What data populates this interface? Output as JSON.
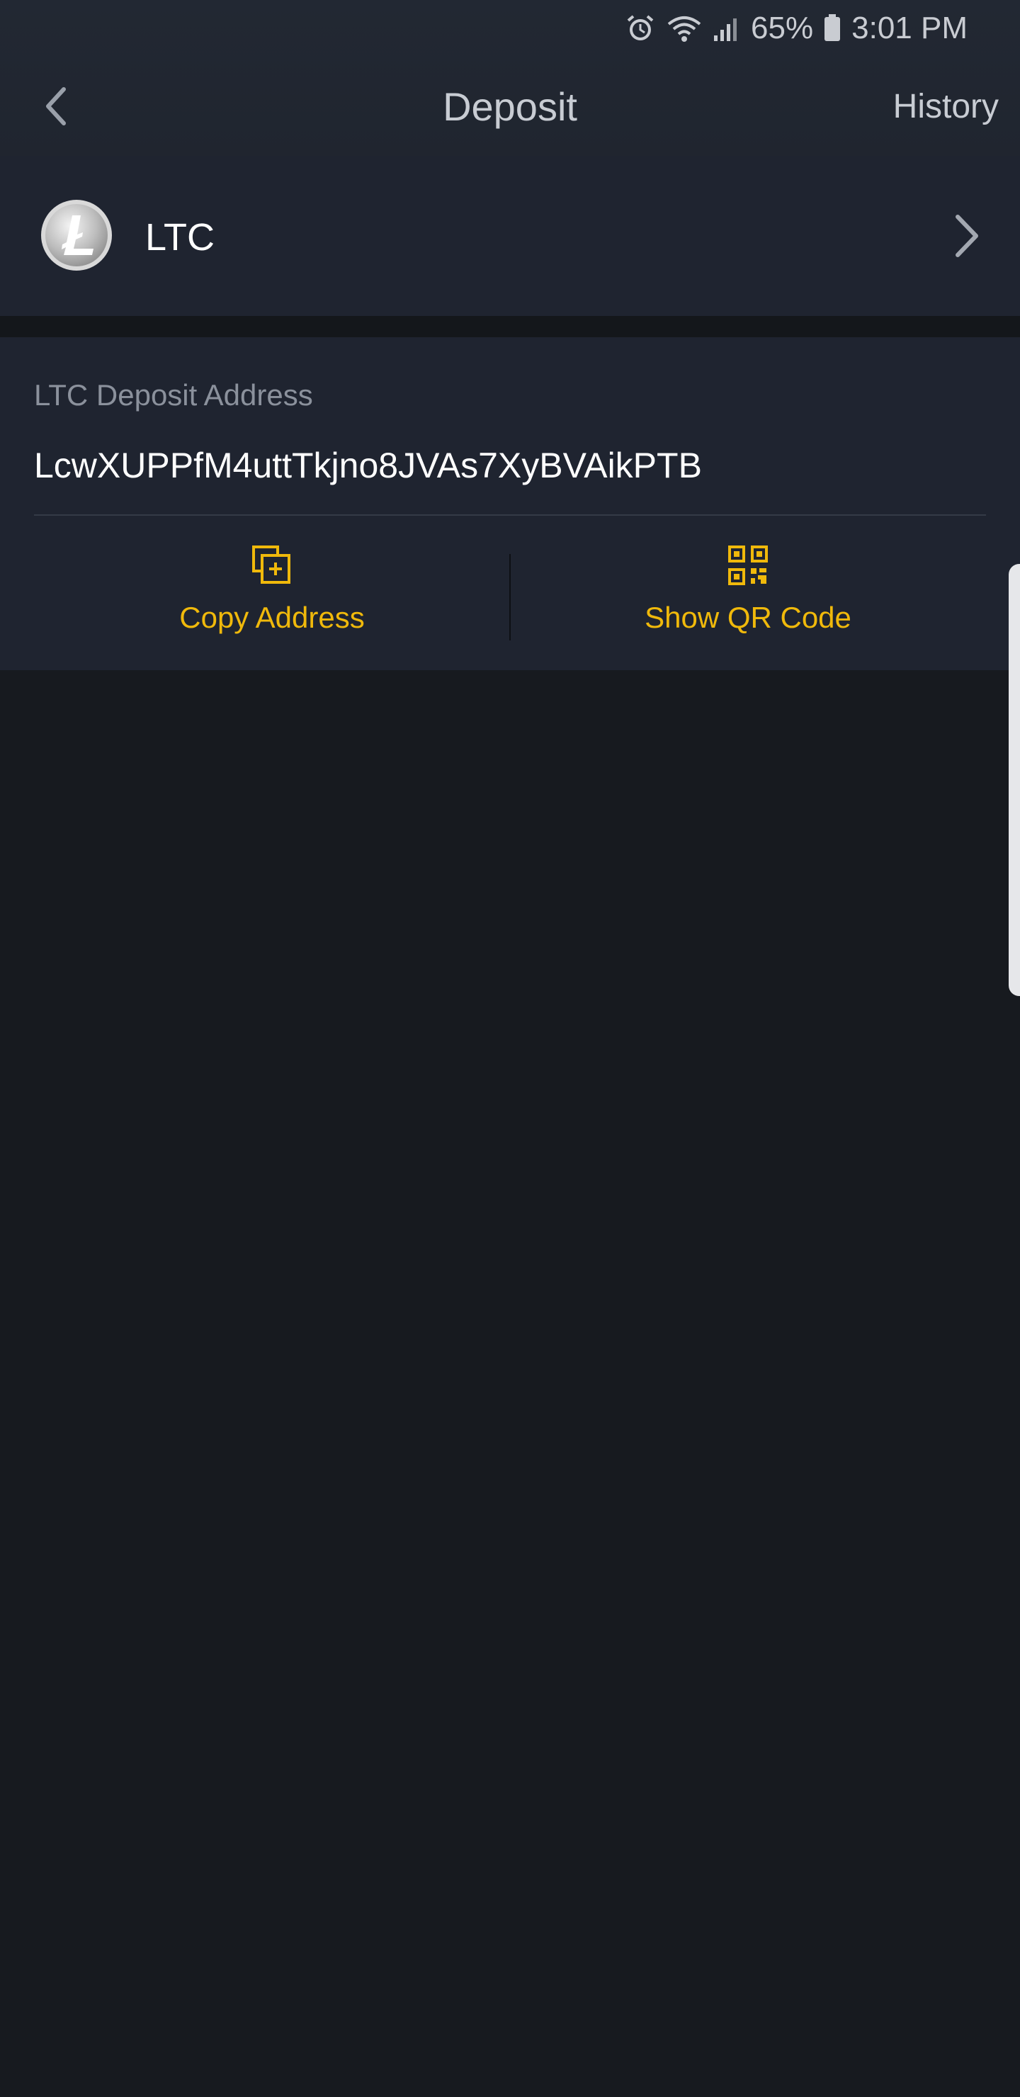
{
  "status_bar": {
    "battery_percent": "65%",
    "time": "3:01 PM",
    "icons": [
      "alarm-icon",
      "wifi-icon",
      "signal-icon",
      "battery-icon"
    ]
  },
  "header": {
    "title": "Deposit",
    "history_label": "History",
    "back_icon": "chevron-left-icon"
  },
  "coin": {
    "symbol": "LTC",
    "logo_icon": "litecoin-logo"
  },
  "deposit": {
    "address_label": "LTC Deposit Address",
    "address": "LcwXUPPfM4uttTkjno8JVAs7XyBVAikPTB"
  },
  "actions": {
    "copy_label": "Copy Address",
    "qr_label": "Show QR Code"
  },
  "colors": {
    "accent": "#f0b90b",
    "background": "#171a1f",
    "card": "#1f2430",
    "header": "#222833"
  }
}
